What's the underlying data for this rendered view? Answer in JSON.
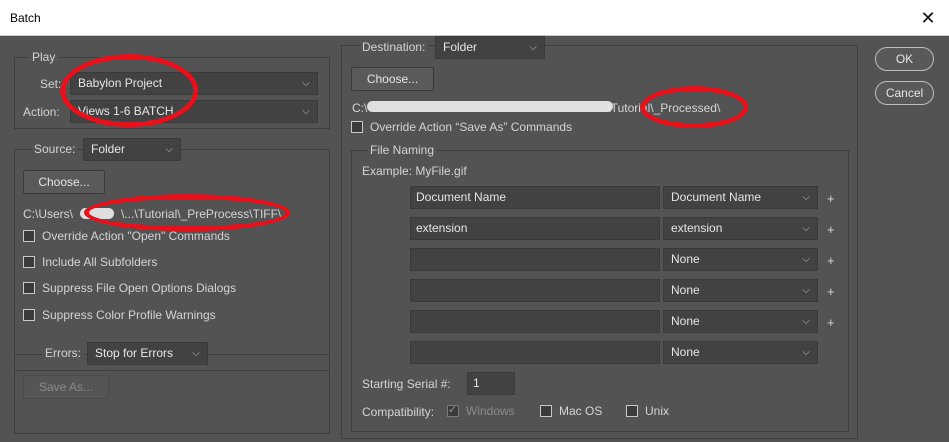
{
  "window": {
    "title": "Batch",
    "close_icon": "✕"
  },
  "play": {
    "legend": "Play",
    "set_label": "Set:",
    "set_value": "Babylon Project",
    "action_label": "Action:",
    "action_value": "Views 1-6 BATCH"
  },
  "source": {
    "label": "Source:",
    "value": "Folder",
    "choose_label": "Choose...",
    "path_prefix": "C:\\Users\\",
    "path_suffix": "\\...\\Tutorial\\_PreProcess\\TIFF\\",
    "options": [
      {
        "label": "Override Action \"Open\" Commands",
        "checked": false
      },
      {
        "label": "Include All Subfolders",
        "checked": false
      },
      {
        "label": "Suppress File Open Options Dialogs",
        "checked": false
      },
      {
        "label": "Suppress Color Profile Warnings",
        "checked": false
      }
    ]
  },
  "errors": {
    "label": "Errors:",
    "value": "Stop for Errors",
    "save_as_label": "Save As..."
  },
  "destination": {
    "label": "Destination:",
    "value": "Folder",
    "choose_label": "Choose...",
    "path_prefix": "C:\\",
    "path_suffix": "\\Tutorial\\_Processed\\",
    "override_label": "Override Action “Save As” Commands",
    "override_checked": false
  },
  "file_naming": {
    "legend": "File Naming",
    "example": "Example: MyFile.gif",
    "rows": [
      {
        "text": "Document Name",
        "select": "Document Name",
        "plus": "+"
      },
      {
        "text": "extension",
        "select": "extension",
        "plus": "+"
      },
      {
        "text": "",
        "select": "None",
        "plus": "+"
      },
      {
        "text": "",
        "select": "None",
        "plus": "+"
      },
      {
        "text": "",
        "select": "None",
        "plus": "+"
      },
      {
        "text": "",
        "select": "None",
        "plus": ""
      }
    ],
    "serial_label": "Starting Serial #:",
    "serial_value": "1",
    "compat_label": "Compatibility:",
    "compat": [
      {
        "label": "Windows",
        "checked": true,
        "disabled": true
      },
      {
        "label": "Mac OS",
        "checked": false,
        "disabled": false
      },
      {
        "label": "Unix",
        "checked": false,
        "disabled": false
      }
    ]
  },
  "buttons": {
    "ok": "OK",
    "cancel": "Cancel"
  },
  "annotation_color": "#e8101a"
}
